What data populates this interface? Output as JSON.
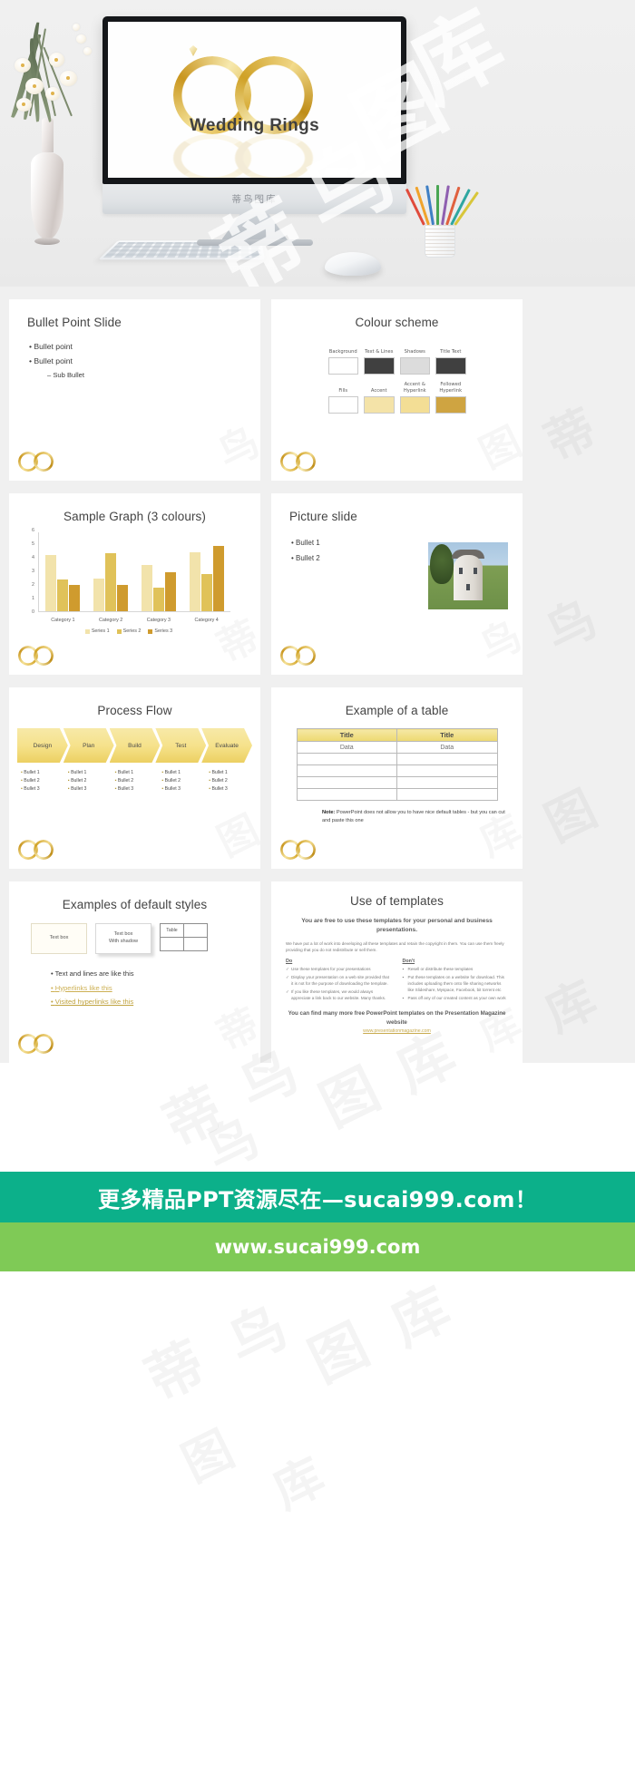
{
  "hero": {
    "title": "Wedding Rings",
    "monitor_brand": "蒂鸟图库",
    "watermark": "蒂鸟图库"
  },
  "watermark": "蒂鸟图库",
  "slides": [
    {
      "id": "bullet-point-slide",
      "title": "Bullet Point Slide",
      "bullets": [
        "Bullet point",
        "Bullet point"
      ],
      "sub_bullet": "Sub Bullet"
    },
    {
      "id": "colour-scheme",
      "title": "Colour scheme",
      "swatches_row1": [
        {
          "label": "Background",
          "color": "#ffffff"
        },
        {
          "label": "Text &\nLines",
          "color": "#404040"
        },
        {
          "label": "Shadows",
          "color": "#dcdcdc"
        },
        {
          "label": "Title\nText",
          "color": "#404040"
        }
      ],
      "swatches_row2": [
        {
          "label": "Fills",
          "color": "#ffffff"
        },
        {
          "label": "Accent",
          "color": "#f4e3a8"
        },
        {
          "label": "Accent &\nHyperlink",
          "color": "#f3de95"
        },
        {
          "label": "Followed\nHyperlink",
          "color": "#cfa441"
        }
      ]
    },
    {
      "id": "sample-graph",
      "title": "Sample Graph (3 colours)"
    },
    {
      "id": "picture-slide",
      "title": "Picture slide",
      "bullets": [
        "Bullet 1",
        "Bullet 2"
      ]
    },
    {
      "id": "process-flow",
      "title": "Process Flow",
      "steps": [
        "Design",
        "Plan",
        "Build",
        "Test",
        "Evaluate"
      ],
      "step_bullets": [
        "Bullet 1",
        "Bullet 2",
        "Bullet 3"
      ]
    },
    {
      "id": "example-table",
      "title": "Example of a table",
      "headers": [
        "Title",
        "Title"
      ],
      "first_row": [
        "Data",
        "Data"
      ],
      "empty_rows": 4,
      "note_label": "Note:",
      "note_text": "PowerPoint does not allow you to have nice default tables - but you can cut and paste this one"
    },
    {
      "id": "default-styles",
      "title": "Examples of default styles",
      "box1": "Text box",
      "box2_line1": "Text box",
      "box2_line2": "With shadow",
      "table_label": "Table",
      "links": [
        {
          "text": "Text and lines are like this",
          "type": "plain"
        },
        {
          "text": "Hyperlinks like this",
          "type": "hyperlink"
        },
        {
          "text": "Visited hyperlinks like this",
          "type": "visited"
        }
      ]
    },
    {
      "id": "use-of-templates",
      "title": "Use of templates",
      "lead": "You are free to use these templates for your personal and business presentations.",
      "body": "We have put a lot of work into developing all these templates and retain the copyright in them.  You can use them freely providing that you do not redistribute or sell them.",
      "do_heading": "Do",
      "do_items": [
        "Use these templates for your presentations",
        "Display your presentation on a web site provided that it is not for the purpose of downloading the template.",
        "If you like these templates, we would always appreciate a link back to our website.  Many thanks."
      ],
      "dont_heading": "Don't",
      "dont_items": [
        "Resell or distribute these templates",
        "Put these templates on a website for download.  This includes uploading them onto file sharing networks like Slideshare, Myspace, Facebook, bit torrent etc",
        "Pass off any of our created content as your own work"
      ],
      "footer": "You can find many more free PowerPoint templates on the Presentation Magazine website",
      "footer_url": "www.presentationmagazine.com"
    }
  ],
  "chart_data": {
    "type": "bar",
    "title": "Sample Graph (3 colours)",
    "categories": [
      "Category 1",
      "Category 2",
      "Category 3",
      "Category 4"
    ],
    "series": [
      {
        "name": "Series 1",
        "color": "#f2e3ab",
        "values": [
          4.3,
          2.5,
          3.5,
          4.5
        ]
      },
      {
        "name": "Series 2",
        "color": "#e0c259",
        "values": [
          2.4,
          4.4,
          1.8,
          2.8
        ]
      },
      {
        "name": "Series 3",
        "color": "#cf9b2e",
        "values": [
          2.0,
          2.0,
          3.0,
          5.0
        ]
      }
    ],
    "yticks": [
      0,
      1,
      2,
      3,
      4,
      5,
      6
    ],
    "ylim": [
      0,
      6
    ],
    "xlabel": "",
    "ylabel": "",
    "grid": false,
    "legend_position": "bottom"
  },
  "footer": {
    "banner_teal": "更多精品PPT资源尽在—sucai999.com！",
    "banner_green": "www.sucai999.com"
  }
}
